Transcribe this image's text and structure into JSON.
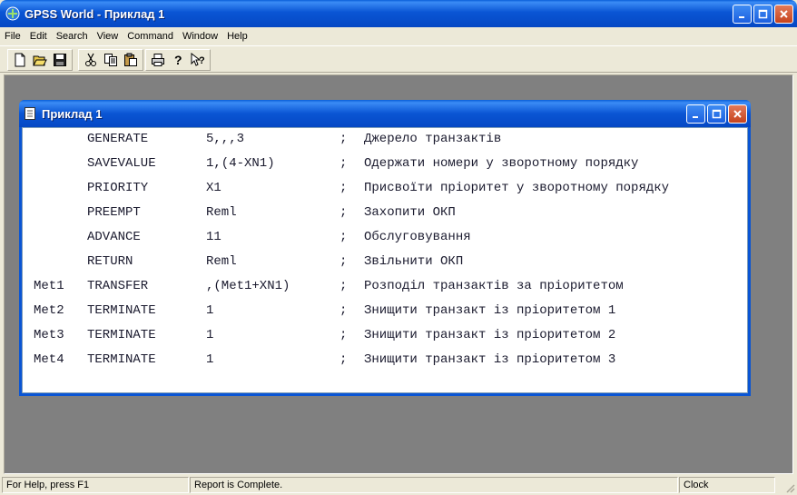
{
  "app": {
    "title": "GPSS World - Приклад 1"
  },
  "menu": [
    "File",
    "Edit",
    "Search",
    "View",
    "Command",
    "Window",
    "Help"
  ],
  "toolbar": {
    "buttons": [
      "new-file",
      "open-folder",
      "save",
      "cut",
      "copy",
      "paste",
      "print",
      "about",
      "context-help"
    ]
  },
  "child": {
    "title": "Приклад 1",
    "lines": [
      {
        "label": "",
        "op": "GENERATE",
        "arg": "5,,,3",
        "semi": ";",
        "comment": "Джерело транзактів"
      },
      {
        "label": "",
        "op": "SAVEVALUE",
        "arg": "1,(4-XN1)",
        "semi": ";",
        "comment": "Одержати номери у зворотному порядку"
      },
      {
        "label": "",
        "op": "PRIORITY",
        "arg": "X1",
        "semi": ";",
        "comment": "Присвоїти пріоритет у зворотному порядку"
      },
      {
        "label": "",
        "op": "PREEMPT",
        "arg": "Reml",
        "semi": ";",
        "comment": "Захопити ОКП"
      },
      {
        "label": "",
        "op": "ADVANCE",
        "arg": "11",
        "semi": ";",
        "comment": "Обслуговування"
      },
      {
        "label": "",
        "op": "RETURN",
        "arg": "Reml",
        "semi": ";",
        "comment": "Звільнити ОКП"
      },
      {
        "label": "Met1",
        "op": "TRANSFER",
        "arg": ",(Met1+XN1)",
        "semi": ";",
        "comment": "Розподіл транзактів за пріоритетом"
      },
      {
        "label": "Met2",
        "op": "TERMINATE",
        "arg": "1",
        "semi": ";",
        "comment": "Знищити транзакт із пріоритетом 1"
      },
      {
        "label": "Met3",
        "op": "TERMINATE",
        "arg": "1",
        "semi": ";",
        "comment": "Знищити транзакт із пріоритетом 2"
      },
      {
        "label": "Met4",
        "op": "TERMINATE",
        "arg": "1",
        "semi": ";",
        "comment": "Знищити транзакт із пріоритетом 3"
      }
    ]
  },
  "status": {
    "help": "For Help, press F1",
    "report": "Report is Complete.",
    "clock": "Clock"
  },
  "colors": {
    "titlebar": "#0a55d4",
    "workspace": "#808080",
    "close_button": "#c6431c"
  }
}
